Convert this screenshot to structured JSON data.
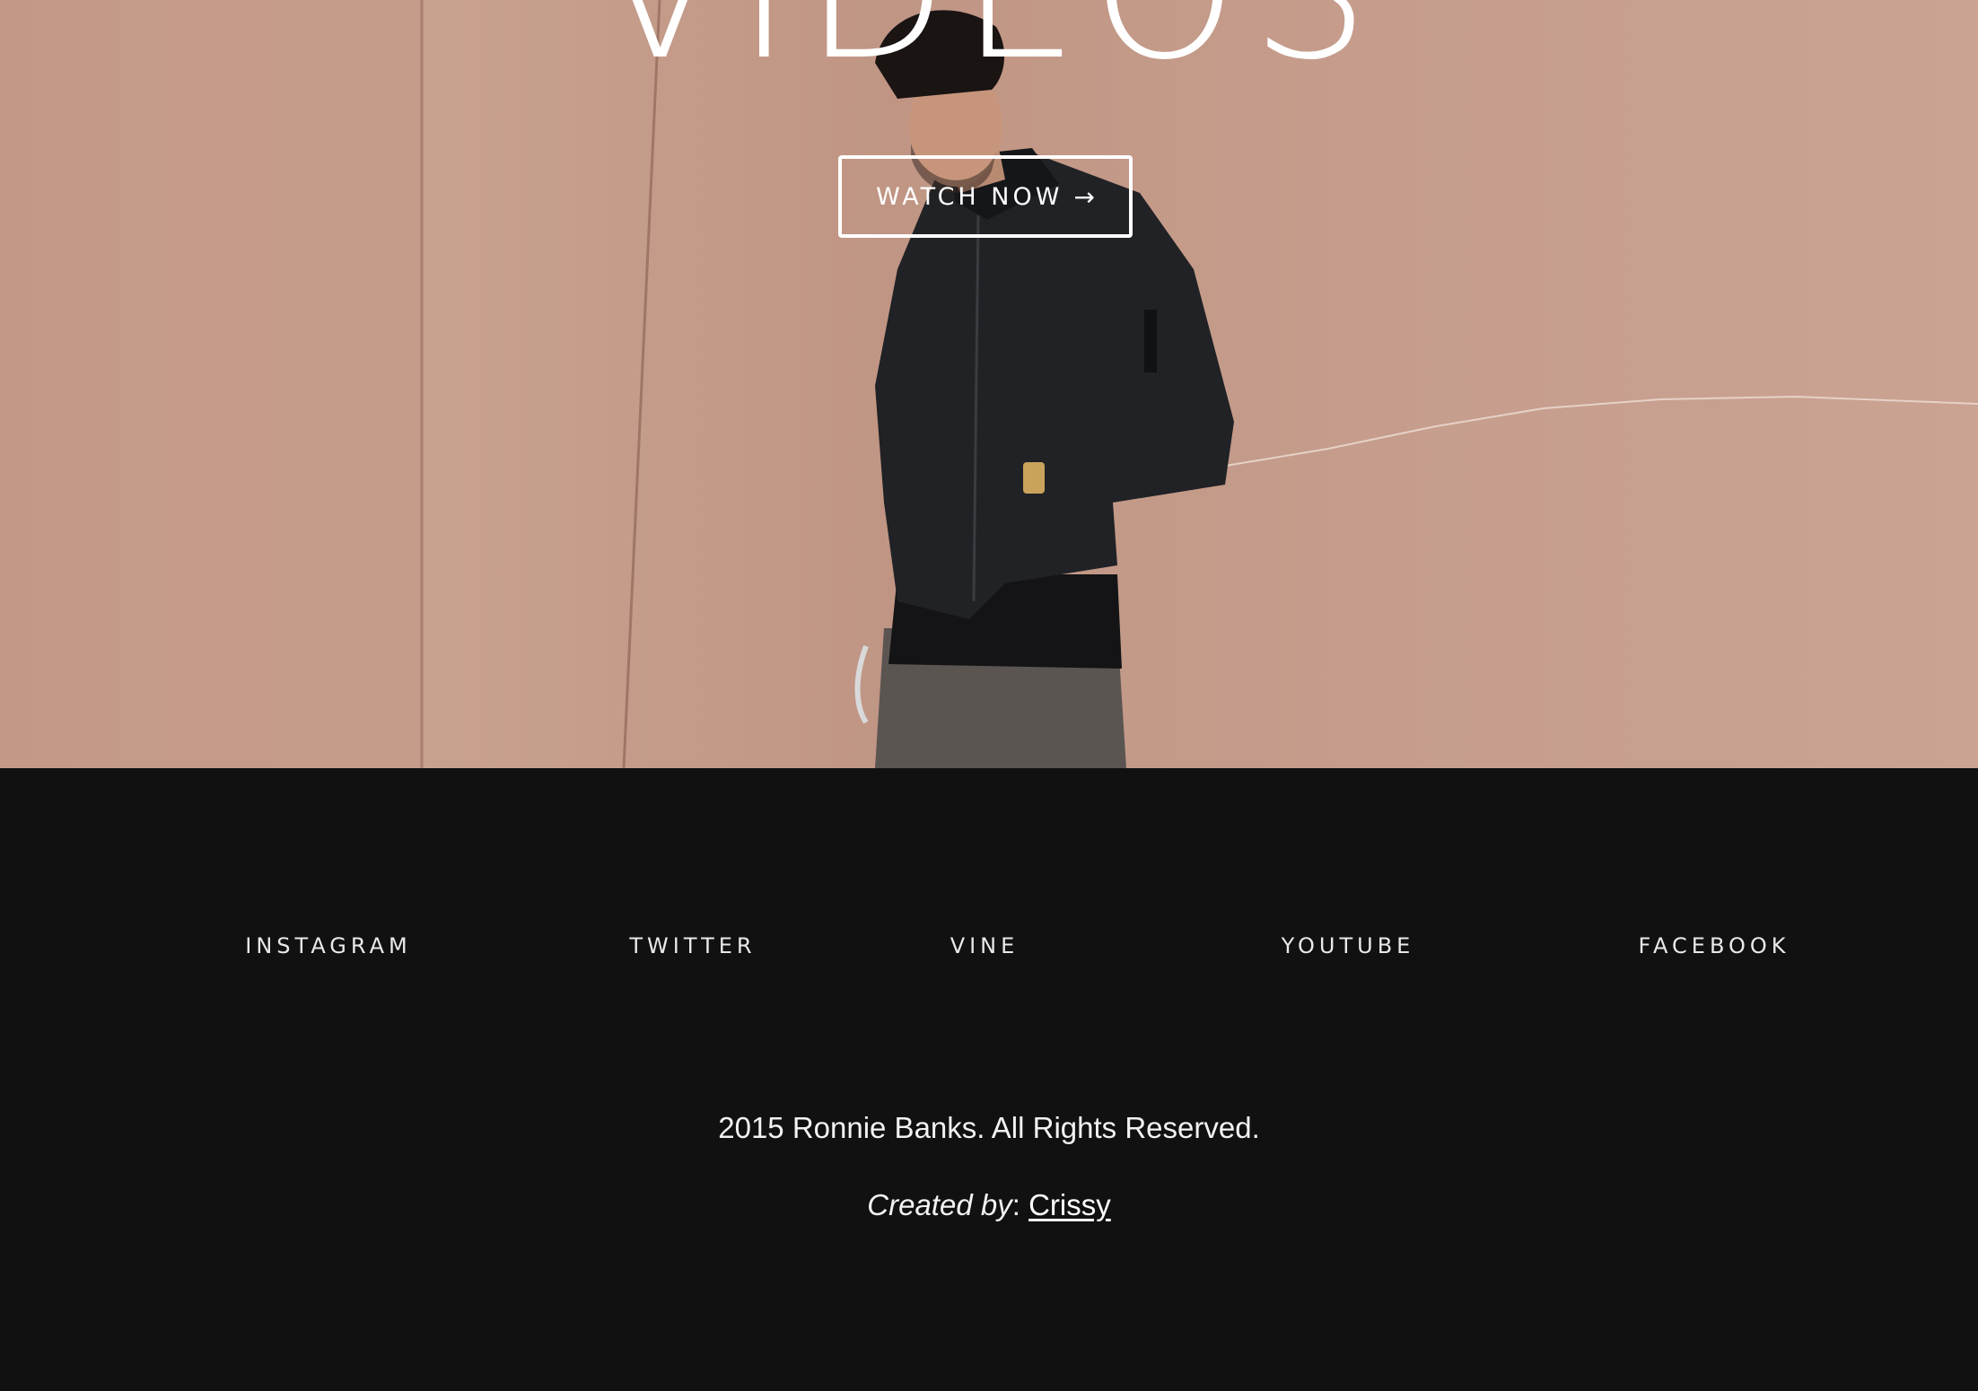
{
  "hero": {
    "title": "VIDEOS",
    "watch_button_label": "WATCH NOW",
    "watch_button_icon": "arrow-right-icon",
    "arrow_glyph": "→",
    "colors": {
      "wall": "#c59a87",
      "jacket": "#202225",
      "pants": "#5b5552"
    }
  },
  "footer": {
    "social": [
      {
        "label": "INSTAGRAM"
      },
      {
        "label": "TWITTER"
      },
      {
        "label": "VINE"
      },
      {
        "label": "YOUTUBE"
      },
      {
        "label": "FACEBOOK"
      }
    ],
    "copyright": "2015 Ronnie Banks. All Rights Reserved.",
    "credit_label": "Created by",
    "credit_separator": ":",
    "credit_name": "Crissy",
    "background": "#111111"
  }
}
